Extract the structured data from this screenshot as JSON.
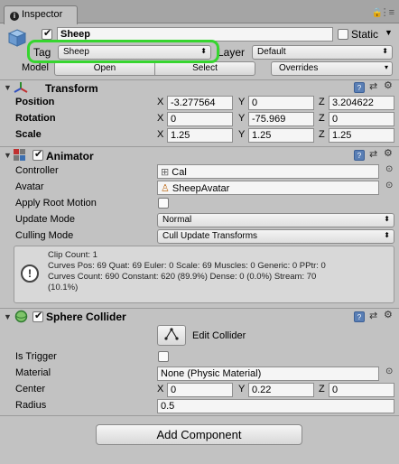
{
  "window": {
    "tab_label": "Inspector",
    "lock_icon": "lock-icon",
    "menu_icon": "menu-dots-icon"
  },
  "gameobject": {
    "icon": "cube-icon",
    "active": true,
    "name": "Sheep",
    "static_label": "Static",
    "static_checked": false,
    "tag_label": "Tag",
    "tag_value": "Sheep",
    "layer_label": "Layer",
    "layer_value": "Default",
    "model_label": "Model",
    "open_button": "Open",
    "select_button": "Select",
    "overrides_value": "Overrides"
  },
  "transform": {
    "title": "Transform",
    "position_label": "Position",
    "rotation_label": "Rotation",
    "scale_label": "Scale",
    "axis_x": "X",
    "axis_y": "Y",
    "axis_z": "Z",
    "position": {
      "x": "-3.277564",
      "y": "0",
      "z": "3.204622"
    },
    "rotation": {
      "x": "0",
      "y": "-75.969",
      "z": "0"
    },
    "scale": {
      "x": "1.25",
      "y": "1.25",
      "z": "1.25"
    }
  },
  "animator": {
    "title": "Animator",
    "enabled": true,
    "controller_label": "Controller",
    "controller_value": "Cal",
    "avatar_label": "Avatar",
    "avatar_value": "SheepAvatar",
    "apply_root_motion_label": "Apply Root Motion",
    "apply_root_motion": false,
    "update_mode_label": "Update Mode",
    "update_mode_value": "Normal",
    "culling_mode_label": "Culling Mode",
    "culling_mode_value": "Cull Update Transforms",
    "info_line1": "Clip Count: 1",
    "info_line2": "Curves Pos: 69 Quat: 69 Euler: 0 Scale: 69 Muscles: 0 Generic: 0 PPtr: 0",
    "info_line3": "Curves Count: 690 Constant: 620 (89.9%) Dense: 0 (0.0%) Stream: 70",
    "info_line4": "(10.1%)"
  },
  "sphere_collider": {
    "title": "Sphere Collider",
    "enabled": true,
    "edit_collider_label": "Edit Collider",
    "is_trigger_label": "Is Trigger",
    "is_trigger": false,
    "material_label": "Material",
    "material_value": "None (Physic Material)",
    "center_label": "Center",
    "center": {
      "x": "0",
      "y": "0.22",
      "z": "0"
    },
    "radius_label": "Radius",
    "radius_value": "0.5"
  },
  "add_component_label": "Add Component",
  "colors": {
    "panel_bg": "#c2c2c2",
    "highlight": "#36d52f",
    "field_bg": "#f5f5f5"
  }
}
